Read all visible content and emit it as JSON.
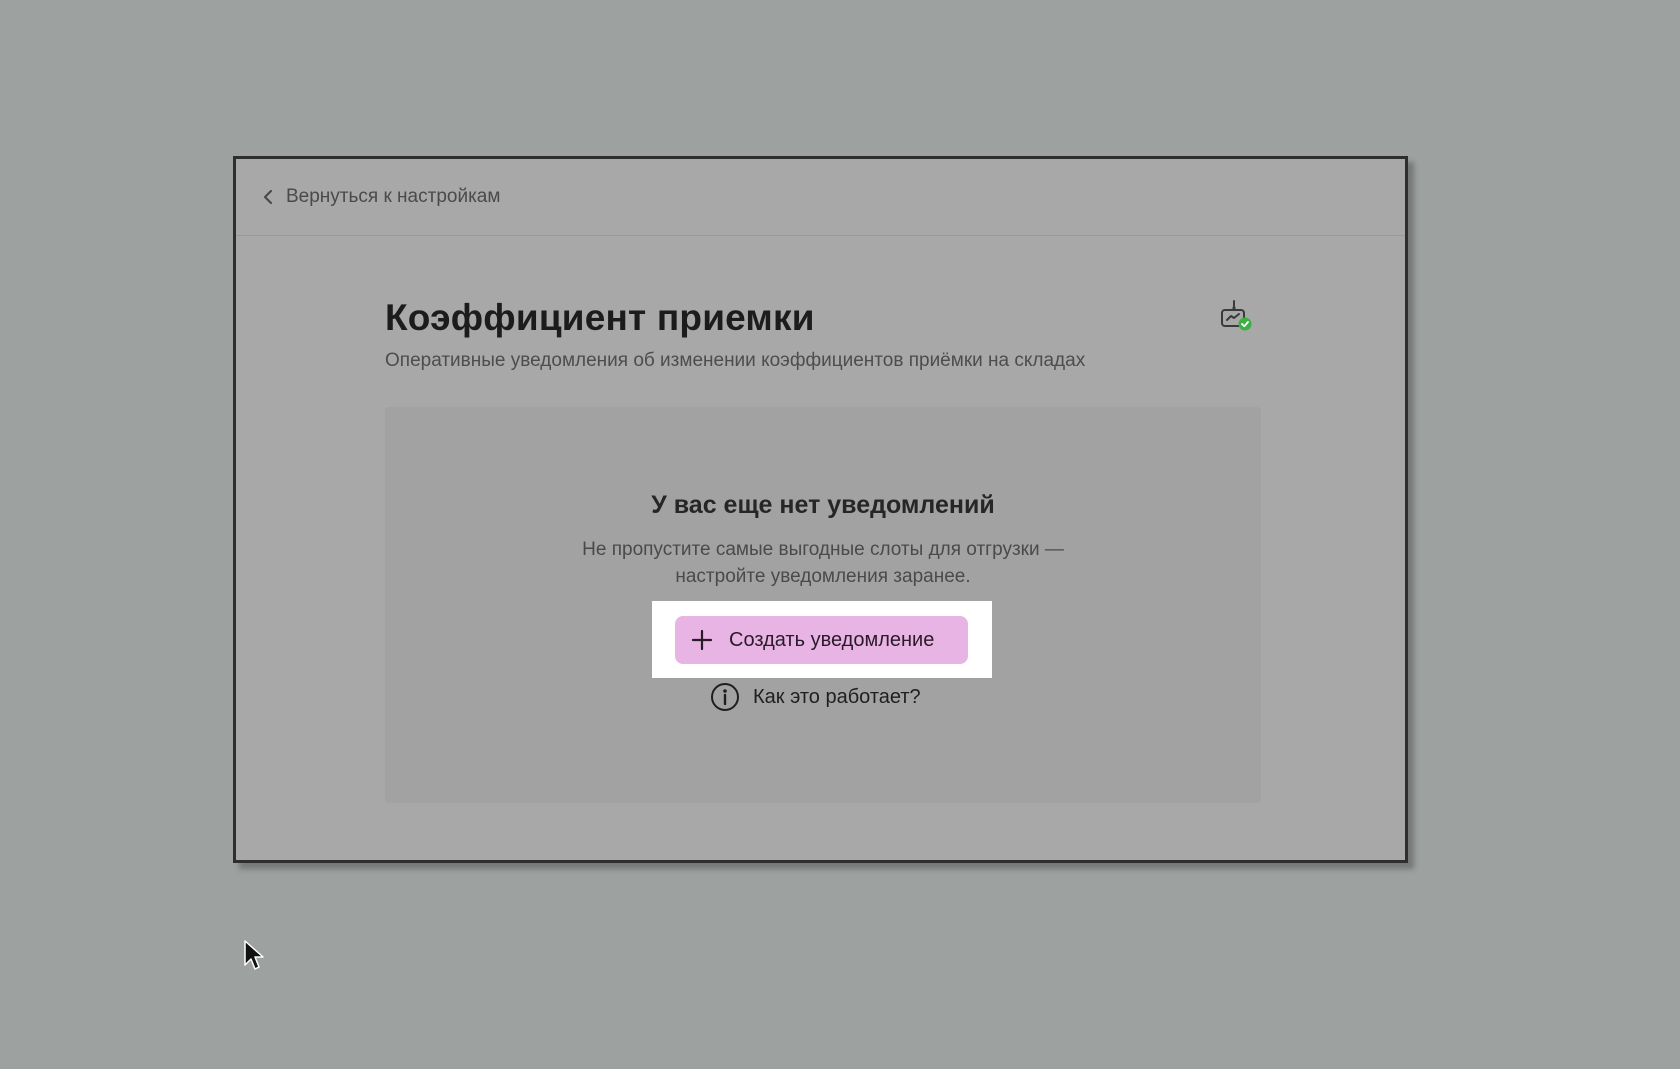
{
  "colors": {
    "backdrop": "#9da19f",
    "window_bg": "#a8a8a8",
    "accent_button": "#e8b4e4",
    "status_ok": "#3cb043"
  },
  "header": {
    "back_label": "Вернуться к настройкам",
    "back_icon": "chevron-left-icon"
  },
  "page": {
    "title": "Коэффициент приемки",
    "subtitle": "Оперативные уведомления об изменении коэффициентов приёмки на складах",
    "status_icon": "notification-settings-check-icon"
  },
  "empty_state": {
    "title": "У вас еще нет уведомлений",
    "description_lines": [
      "Не пропустите самые выгодные слоты для отгрузки —",
      "настройте уведомления заранее."
    ],
    "create_button_label": "Создать уведомление",
    "create_button_icon": "plus-icon",
    "help_link_label": "Как это работает?",
    "help_icon": "info-icon"
  }
}
